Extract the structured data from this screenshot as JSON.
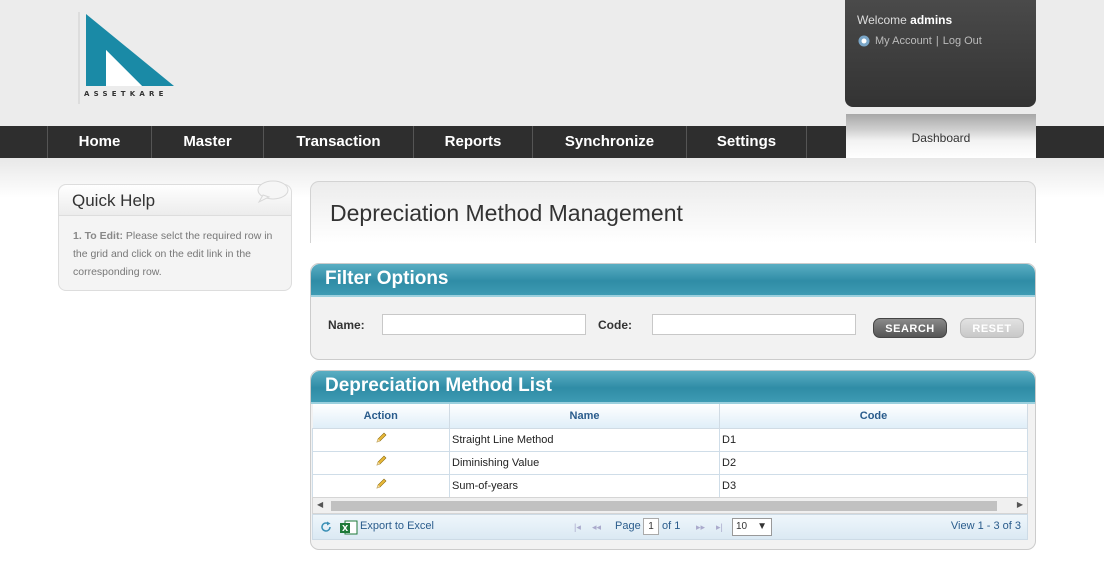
{
  "logo": {
    "text": "ASSETKARE"
  },
  "account": {
    "welcome_prefix": "Welcome",
    "username": "admins",
    "my_account": "My Account",
    "separator": "|",
    "logout": "Log Out"
  },
  "nav": {
    "items": [
      "Home",
      "Master",
      "Transaction",
      "Reports",
      "Synchronize",
      "Settings"
    ],
    "dashboard": "Dashboard"
  },
  "quick_help": {
    "title": "Quick Help",
    "step_label": "1. To Edit:",
    "step_text": "Please selct the required row in the grid and click on the edit link in the corresponding row."
  },
  "page": {
    "title": "Depreciation Method Management"
  },
  "filter": {
    "title": "Filter Options",
    "name_label": "Name:",
    "name_value": "",
    "code_label": "Code:",
    "code_value": "",
    "search_label": "SEARCH",
    "reset_label": "RESET"
  },
  "list": {
    "title": "Depreciation Method List",
    "columns": {
      "action": "Action",
      "name": "Name",
      "code": "Code"
    },
    "rows": [
      {
        "name": "Straight Line Method",
        "code": "D1"
      },
      {
        "name": "Diminishing Value",
        "code": "D2"
      },
      {
        "name": "Sum-of-years",
        "code": "D3"
      }
    ]
  },
  "pager": {
    "export_label": "Export to Excel",
    "page_label": "Page",
    "page_value": "1",
    "of_label": "of 1",
    "rows_per_page": "10",
    "view_text": "View 1 - 3 of 3"
  },
  "colors": {
    "header_accent": "#2f8ca6",
    "nav_bg": "#2e2e2e",
    "logo": "#1a8aa6"
  },
  "icons": [
    "user-icon",
    "speech-bubble-icon",
    "pencil-icon",
    "refresh-icon",
    "excel-icon",
    "first-page-icon",
    "prev-page-icon",
    "next-page-icon",
    "last-page-icon",
    "scroll-left-icon",
    "scroll-right-icon",
    "dropdown-arrow-icon"
  ]
}
